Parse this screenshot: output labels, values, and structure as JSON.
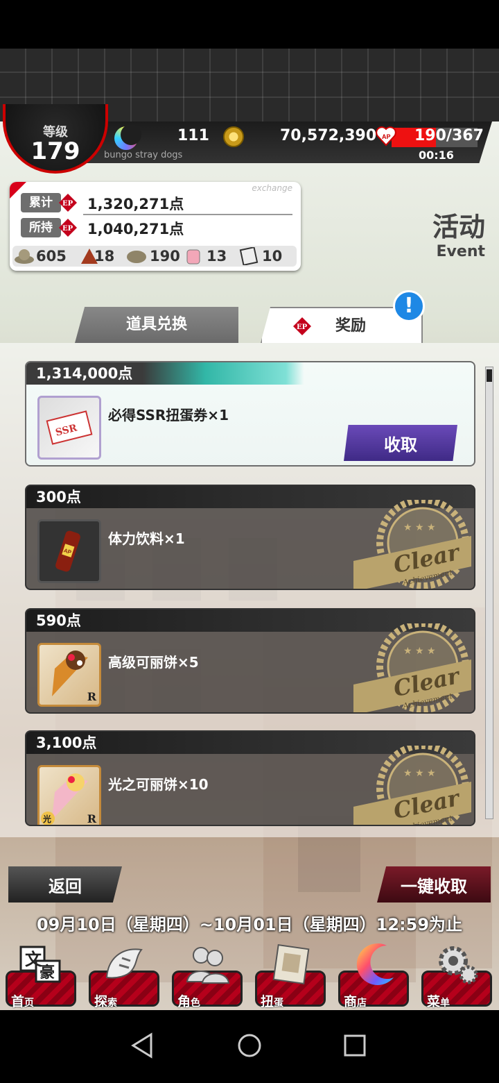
{
  "header": {
    "level_label": "等级",
    "level_value": "179",
    "spirit": "111",
    "gold": "70,572,390",
    "ap": "190/367",
    "ap_fraction": 0.5177,
    "ap_timer": "00:16",
    "game_name": "bungo stray dogs"
  },
  "exchange_panel": {
    "watermark": "exchange",
    "total_label": "累计",
    "total_value": "1,320,271点",
    "held_label": "所持",
    "held_value": "1,040,271点",
    "ep_badge": "EP",
    "inventory": [
      {
        "icon": "hat-icon",
        "count": "605"
      },
      {
        "icon": "coat-icon",
        "count": "18"
      },
      {
        "icon": "beret-icon",
        "count": "190"
      },
      {
        "icon": "jar-icon",
        "count": "13"
      },
      {
        "icon": "ticket-icon",
        "count": "10"
      }
    ]
  },
  "page": {
    "title": "活动",
    "subtitle": "Event"
  },
  "tabs": {
    "exchange": "道具兑换",
    "reward": "奖励",
    "alert": "!"
  },
  "rewards": [
    {
      "points": "1,314,000点",
      "item": "必得SSR扭蛋券×1",
      "state": "claimable",
      "claim_label": "收取",
      "ticket_text": "SSR"
    },
    {
      "points": "300点",
      "item": "体力饮料×1",
      "state": "cleared",
      "bottle_text": "AP"
    },
    {
      "points": "590点",
      "item": "高级可丽饼×5",
      "state": "cleared",
      "rarity": "R"
    },
    {
      "points": "3,100点",
      "item": "光之可丽饼×10",
      "state": "cleared",
      "rarity": "R",
      "badge_text": "光"
    }
  ],
  "stamp": {
    "word": "Clear",
    "sub": "Achievement",
    "stars": "★ ★ ★"
  },
  "footer": {
    "back_label": "返回",
    "claim_all_label": "一键收取",
    "period": "09月10日（星期四）~10月01日（星期四）12:59为止"
  },
  "nav": [
    {
      "icon": "bungo-logo-icon",
      "label": "首",
      "sub": "页",
      "logo_a": "文",
      "logo_b": "豪"
    },
    {
      "icon": "tiger-icon",
      "label": "探",
      "sub": "索"
    },
    {
      "icon": "characters-icon",
      "label": "角",
      "sub": "色"
    },
    {
      "icon": "book-icon",
      "label": "扭",
      "sub": "蛋"
    },
    {
      "icon": "moon-shop-icon",
      "label": "商",
      "sub": "店"
    },
    {
      "icon": "gear-icon",
      "label": "菜",
      "sub": "单"
    }
  ],
  "colors": {
    "accent_red": "#d8001a",
    "claim_purple": "#4f3598",
    "teal": "#32b7a7"
  }
}
